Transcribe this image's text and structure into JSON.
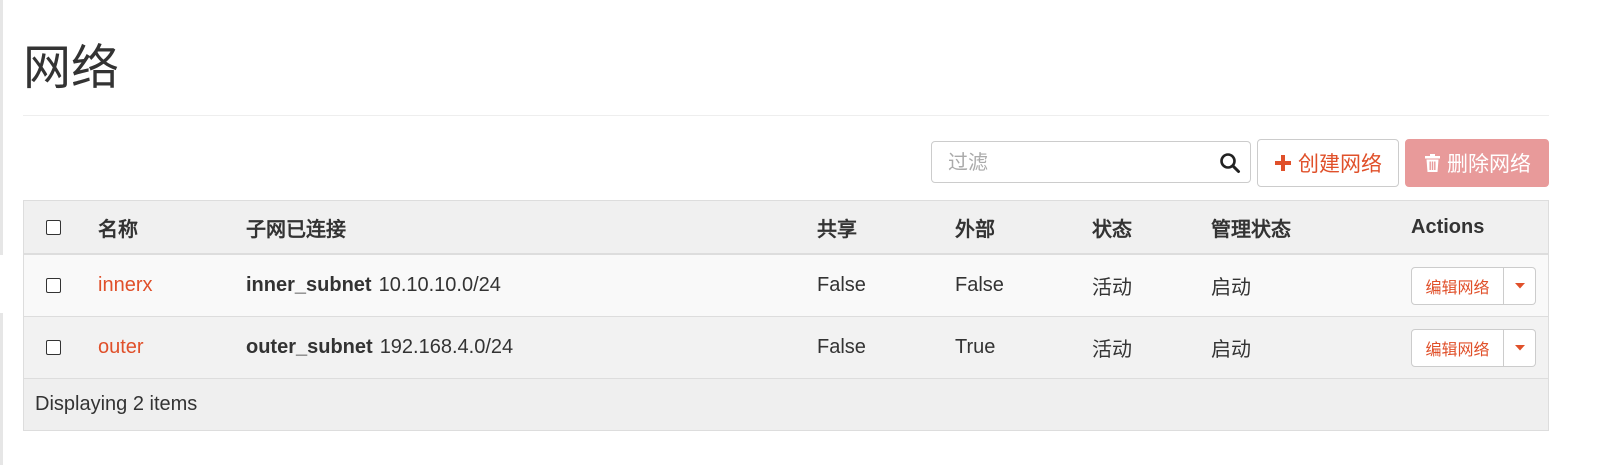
{
  "page": {
    "title": "网络"
  },
  "toolbar": {
    "filter_placeholder": "过滤",
    "create_label": "创建网络",
    "delete_label": "删除网络",
    "accent_color": "#e0502a",
    "delete_color": "#e89a9a"
  },
  "table": {
    "columns": {
      "name": "名称",
      "subnets": "子网已连接",
      "shared": "共享",
      "external": "外部",
      "status": "状态",
      "admin_state": "管理状态",
      "actions": "Actions"
    },
    "rows": [
      {
        "name": "innerx",
        "subnet_name": "inner_subnet",
        "subnet_cidr": "10.10.10.0/24",
        "shared": "False",
        "external": "False",
        "status": "活动",
        "admin_state": "启动",
        "action_label": "编辑网络"
      },
      {
        "name": "outer",
        "subnet_name": "outer_subnet",
        "subnet_cidr": "192.168.4.0/24",
        "shared": "False",
        "external": "True",
        "status": "活动",
        "admin_state": "启动",
        "action_label": "编辑网络"
      }
    ],
    "footer": "Displaying 2 items"
  },
  "icons": {
    "search": "search-icon",
    "create": "plus-icon",
    "delete": "trash-icon",
    "dropdown": "caret-down-icon"
  }
}
